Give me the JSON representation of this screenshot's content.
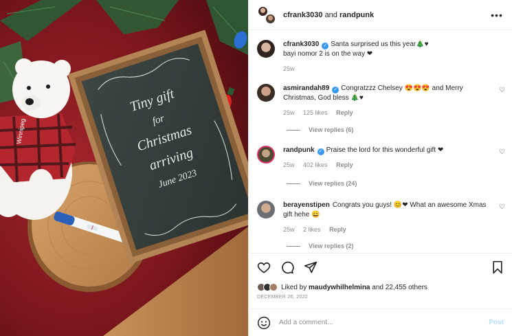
{
  "photo": {
    "board_lines": [
      "Tiny gift",
      "for",
      "Christmas",
      "arriving",
      "June 2023"
    ],
    "tag_text": "Winnipeg"
  },
  "header": {
    "user1": "cfrank3030",
    "joiner": "and",
    "user2": "randpunk"
  },
  "caption": {
    "user": "cfrank3030",
    "text_line1": "Santa surprised us this year🎄♥",
    "text_line2": "bayi nomor 2 is on the way ❤",
    "time": "25w"
  },
  "comments": [
    {
      "user": "asmirandah89",
      "verified": true,
      "text": "Congratzzz Chelsey 😍😍😍 and Merry Christmas, God bless 🎄♥",
      "time": "25w",
      "likes": "125 likes",
      "reply": "Reply",
      "view_replies": "View replies (6)"
    },
    {
      "user": "randpunk",
      "verified": true,
      "text": "Praise the lord for this wonderful gift ❤",
      "time": "25w",
      "likes": "402 likes",
      "reply": "Reply",
      "view_replies": "View replies (24)"
    },
    {
      "user": "berayenstipen",
      "verified": false,
      "text": "Congrats you guys! 😊❤ What an awesome Xmas gift hehe 😄",
      "time": "25w",
      "likes": "2 likes",
      "reply": "Reply",
      "view_replies": "View replies (2)"
    }
  ],
  "icons": {
    "heart": "heart-icon",
    "comment": "comment-icon",
    "share": "share-icon",
    "save": "bookmark-icon",
    "more": "more-icon",
    "emoji": "smile-icon"
  },
  "likes": {
    "prefix": "Liked by",
    "user": "maudywhilhelmina",
    "suffix": "and 22,455 others"
  },
  "date": "DECEMBER 26, 2022",
  "add_comment": {
    "placeholder": "Add a comment...",
    "post_label": "Post"
  },
  "colors": {
    "verified": "#3897f0",
    "post_disabled": "#b2dffc",
    "secondary_text": "#8e8e8e"
  }
}
